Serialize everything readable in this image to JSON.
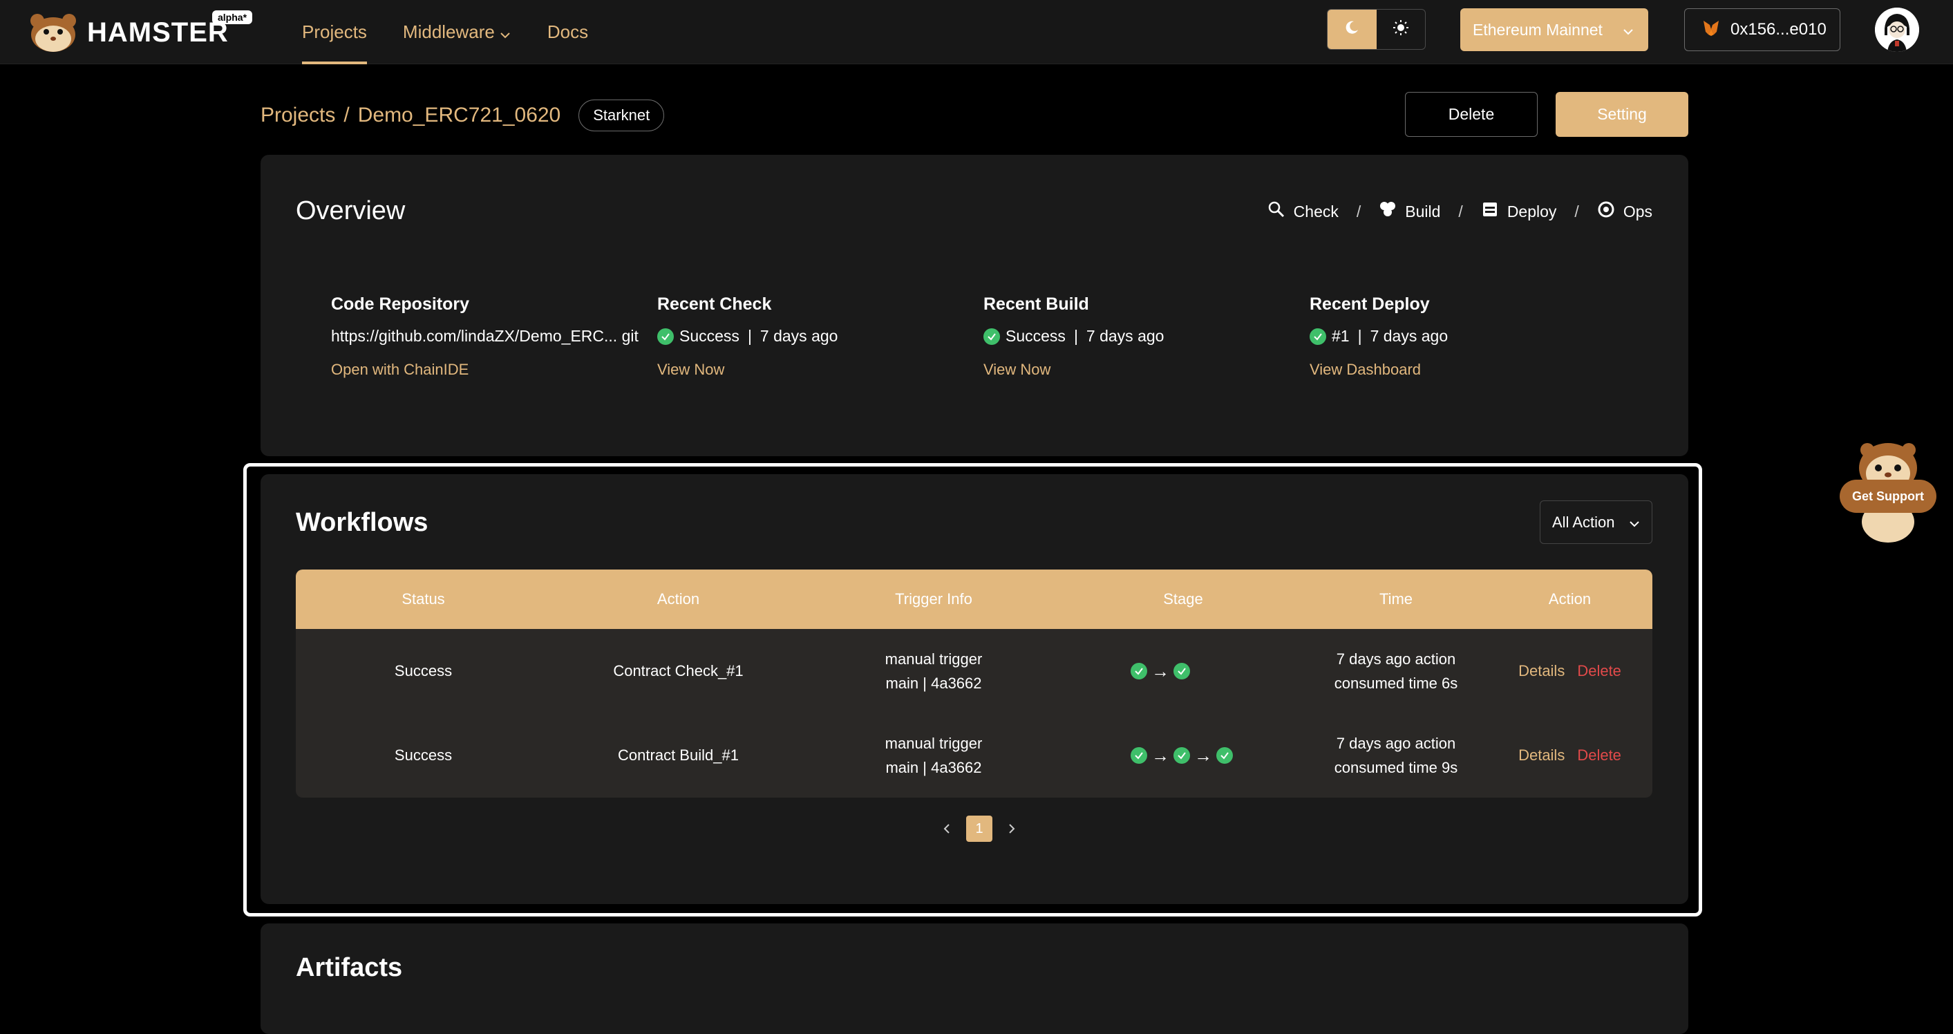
{
  "app": {
    "name": "HAMSTER",
    "badge": "alpha*"
  },
  "nav": {
    "items": [
      {
        "label": "Projects"
      },
      {
        "label": "Middleware"
      },
      {
        "label": "Docs"
      }
    ]
  },
  "header_controls": {
    "network": "Ethereum Mainnet",
    "wallet": "0x156...e010",
    "theme_icons": [
      "moon-icon",
      "sun-icon"
    ]
  },
  "breadcrumb": {
    "root": "Projects",
    "separator": "/",
    "project": "Demo_ERC721_0620",
    "chain": "Starknet"
  },
  "page_actions": {
    "delete": "Delete",
    "setting": "Setting"
  },
  "overview": {
    "title": "Overview",
    "phases": [
      {
        "label": "Check",
        "icon": "magnifier-icon"
      },
      {
        "label": "Build",
        "icon": "cubes-icon"
      },
      {
        "label": "Deploy",
        "icon": "server-icon"
      },
      {
        "label": "Ops",
        "icon": "shield-gear-icon"
      }
    ],
    "phase_separator": "/",
    "code_repo": {
      "title": "Code Repository",
      "url": "https://github.com/lindaZX/Demo_ERC... git",
      "link": "Open with ChainIDE"
    },
    "recent_check": {
      "title": "Recent Check",
      "status": "Success",
      "time": "7 days ago",
      "link": "View Now"
    },
    "recent_build": {
      "title": "Recent Build",
      "status": "Success",
      "time": "7 days ago",
      "link": "View Now"
    },
    "recent_deploy": {
      "title": "Recent Deploy",
      "status": "#1",
      "time": "7 days ago",
      "link": "View Dashboard"
    }
  },
  "workflows": {
    "title": "Workflows",
    "filter": "All Action",
    "columns": [
      "Status",
      "Action",
      "Trigger Info",
      "Stage",
      "Time",
      "Action"
    ],
    "rows": [
      {
        "status": "Success",
        "action": "Contract Check_#1",
        "trigger_line1": "manual trigger",
        "trigger_line2": "main | 4a3662",
        "stages": 2,
        "time_line1": "7 days ago action",
        "time_line2": "consumed time 6s",
        "details": "Details",
        "delete": "Delete"
      },
      {
        "status": "Success",
        "action": "Contract Build_#1",
        "trigger_line1": "manual trigger",
        "trigger_line2": "main | 4a3662",
        "stages": 3,
        "time_line1": "7 days ago action",
        "time_line2": "consumed time 9s",
        "details": "Details",
        "delete": "Delete"
      }
    ],
    "pagination": {
      "current": "1"
    }
  },
  "artifacts": {
    "title": "Artifacts"
  },
  "support": {
    "label": "Get Support"
  },
  "colors": {
    "accent": "#e2b87e",
    "success": "#3fbf6a",
    "danger": "#e24a4a",
    "panel": "#1a1a1a",
    "background": "#000000"
  }
}
